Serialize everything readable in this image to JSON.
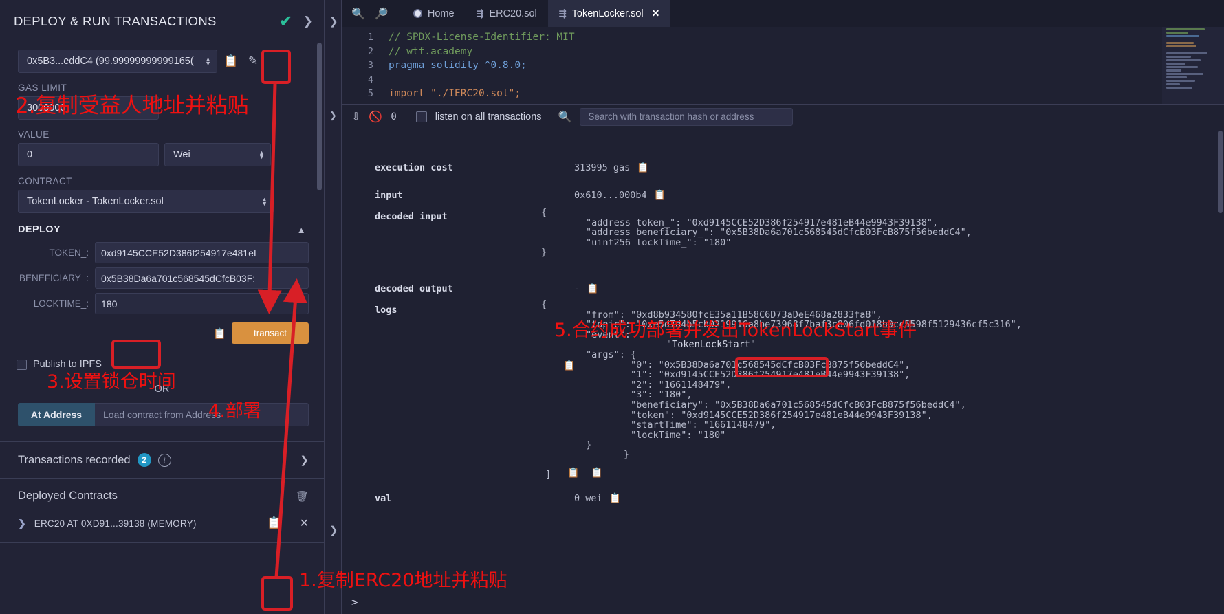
{
  "left_panel": {
    "title": "DEPLOY & RUN TRANSACTIONS",
    "check_icon": "check-icon",
    "expand_icon": "chevron-right-icon",
    "account": {
      "value": "0x5B3...eddC4 (99.99999999999165(",
      "copy_icon": "copy-icon",
      "edit_icon": "edit-icon"
    },
    "gas_limit": {
      "label": "GAS LIMIT",
      "value": "3000000"
    },
    "value_field": {
      "label": "VALUE",
      "value": "0",
      "unit": "Wei"
    },
    "contract": {
      "label": "CONTRACT",
      "value": "TokenLocker - TokenLocker.sol"
    },
    "deploy": {
      "label": "DEPLOY",
      "args": [
        {
          "label": "TOKEN_:",
          "value": "0xd9145CCE52D386f254917e481eI"
        },
        {
          "label": "BENEFICIARY_:",
          "value": "0x5B38Da6a701c568545dCfcB03F:"
        },
        {
          "label": "LOCKTIME_:",
          "value": "180"
        }
      ],
      "copy_icon": "copy-icon",
      "transact_label": "transact"
    },
    "ipfs": {
      "label": "Publish to IPFS",
      "checked": false
    },
    "or_label": "OR",
    "at_address": {
      "button": "At Address",
      "placeholder": "Load contract from Address"
    },
    "transactions_recorded": {
      "label": "Transactions recorded",
      "count": "2",
      "info_icon": "info-icon",
      "chevron_icon": "chevron-right-icon"
    },
    "deployed_contracts": {
      "label": "Deployed Contracts",
      "trash_icon": "trash-icon",
      "items": [
        {
          "name": "ERC20 AT 0XD91...39138 (MEMORY)",
          "chevron_icon": "chevron-right-icon",
          "copy_icon": "copy-icon",
          "close_icon": "close-icon"
        }
      ]
    }
  },
  "editor": {
    "zoom_out_icon": "zoom-out-icon",
    "zoom_in_icon": "zoom-in-icon",
    "tabs": [
      {
        "label": "Home",
        "icon": "home-icon",
        "active": false,
        "closable": false
      },
      {
        "label": "ERC20.sol",
        "icon": "solidity-icon",
        "active": false,
        "closable": false
      },
      {
        "label": "TokenLocker.sol",
        "icon": "solidity-icon",
        "active": true,
        "closable": true
      }
    ],
    "code_lines": [
      {
        "num": "1",
        "text": "// SPDX-License-Identifier: MIT"
      },
      {
        "num": "2",
        "text": "// wtf.academy"
      },
      {
        "num": "3",
        "text": "pragma solidity ^0.8.0;"
      },
      {
        "num": "4",
        "text": ""
      },
      {
        "num": "5",
        "text": "import \"./IERC20.sol\";"
      }
    ]
  },
  "terminal": {
    "toolbar": {
      "collapse_icon": "chevrons-down-icon",
      "clear_icon": "ban-icon",
      "pending_count": "0",
      "listen_label": "listen on all transactions",
      "listen_checked": false,
      "search_icon": "search-icon",
      "search_placeholder": "Search with transaction hash or address"
    },
    "rows": [
      {
        "key": "execution cost",
        "value": "313995 gas",
        "copy_icon": "copy-icon"
      },
      {
        "key": "input",
        "value": "0x610...000b4",
        "copy_icon": "copy-icon"
      },
      {
        "key": "decoded input",
        "value": "",
        "copy_icon": "copy-icon"
      },
      {
        "key": "decoded output",
        "value": "-",
        "copy_icon": "copy-icon"
      },
      {
        "key": "logs",
        "value": "",
        "copy_icon": "copy-icon"
      },
      {
        "key": "val",
        "value": "0 wei",
        "copy_icon": "copy-icon"
      }
    ],
    "decoded_input_json": "{\n\t\"address token_\": \"0xd9145CCE52D386f254917e481eB44e9943F39138\",\n\t\"address beneficiary_\": \"0x5B38Da6a701c568545dCfcB03FcB875f56beddC4\",\n\t\"uint256 lockTime_\": \"180\"\n}",
    "logs_json_head": "{\n\t\"from\": \"0xd8b934580fcE35a11B58C6D73aDeE468a2833fa8\",\n\t\"topic\": \"0xe5d7d4b5cb0219916a8be73968f7baf3c806fd018b0cc5598f5129436cf5c316\",\n\t\"event\": ",
    "logs_event_value": "\"TokenLockStart\"",
    "logs_json_args": "\t\"args\": {\n\t\t\"0\": \"0x5B38Da6a701c568545dCfcB03FcB875f56beddC4\",\n\t\t\"1\": \"0xd9145CCE52D386f254917e481eB44e9943F39138\",\n\t\t\"2\": \"1661148479\",\n\t\t\"3\": \"180\",\n\t\t\"beneficiary\": \"0x5B38Da6a701c568545dCfcB03FcB875f56beddC4\",\n\t\t\"token\": \"0xd9145CCE52D386f254917e481eB44e9943F39138\",\n\t\t\"startTime\": \"1661148479\",\n\t\t\"lockTime\": \"180\"\n\t}",
    "prompt": ">"
  },
  "annotations": [
    {
      "id": "step1",
      "text": "1.复制ERC20地址并粘贴"
    },
    {
      "id": "step2",
      "text": "2.复制受益人地址并粘贴"
    },
    {
      "id": "step3",
      "text": "3.设置锁仓时间"
    },
    {
      "id": "step4",
      "text": "4.部署"
    },
    {
      "id": "step5",
      "text": "5.合约成功部署并发出TokenLockStart事件"
    }
  ],
  "colors": {
    "accent_red": "#ee1111",
    "box_red": "#d81f26",
    "transact_orange": "#d9913f",
    "badge_blue": "#2196c4",
    "check_green": "#2bbf9a",
    "panel_bg": "#222336",
    "editor_bg": "#1f2132"
  }
}
